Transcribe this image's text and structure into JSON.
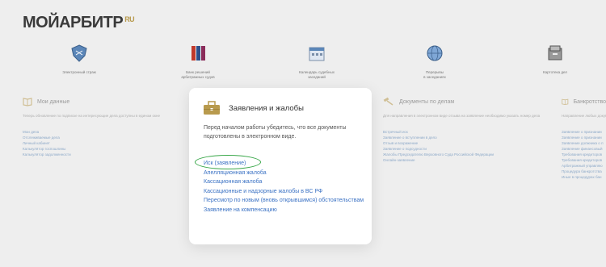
{
  "logo": {
    "part1": "МОЙ",
    "part2": "АРБИТР",
    "suffix": "RU"
  },
  "top_nav": [
    {
      "icon": "shield-icon",
      "label": "Электронный страж",
      "label2": ""
    },
    {
      "icon": "books-icon",
      "label": "Банк решений",
      "label2": "арбитражных судов"
    },
    {
      "icon": "calendar-icon",
      "label": "Календарь судебных",
      "label2": "заседаний"
    },
    {
      "icon": "globe-icon",
      "label": "Перерывы",
      "label2": "в заседаниях"
    },
    {
      "icon": "cards-icon",
      "label": "Картотека дел",
      "label2": ""
    }
  ],
  "left_col": {
    "title": "Мои данные",
    "desc": "Теперь обновление по подписке на интересующие дела доступны в едином окне",
    "links": [
      "Мои дела",
      "Отслеживаемые дела",
      "Личный кабинет",
      "Калькулятор госпошлины",
      "Калькулятор задолженности"
    ]
  },
  "right_col": {
    "title": "Документы по делам",
    "desc": "Для направления в электронном виде отзыва на заявление необходимо указать номер дела",
    "links": [
      "Встречный иск",
      "Заявление о вступлении в дело",
      "Отзыв и возражение",
      "Заявление о подсудности",
      "Жалобы Председателю Верховного Суда Российской Федерации",
      "Онлайн-заявление"
    ]
  },
  "far_right_col": {
    "title": "Банкротство",
    "desc": "Направление любых докум",
    "links": [
      "Заявление о признании",
      "Заявление о признании",
      "Заявление должника о п",
      "Заявление финансовый",
      "Требования кредиторов",
      "Требования кредиторов",
      "Арбитражный управляю",
      "Процедура банкротства",
      "Иные в процедурах бан"
    ]
  },
  "modal": {
    "title": "Заявления и жалобы",
    "description": "Перед началом работы убедитесь, что все документы подготовлены в электронном виде.",
    "links": [
      "Иск (заявление)",
      "Апелляционная жалоба",
      "Кассационная жалоба",
      "Кассационные и надзорные жалобы в ВС РФ",
      "Пересмотр по новым (вновь открывшимся) обстоятельствам",
      "Заявление на компенсацию"
    ]
  },
  "colors": {
    "accent": "#b89a4d",
    "link": "#3b72c4",
    "highlight": "#3aa84a"
  }
}
